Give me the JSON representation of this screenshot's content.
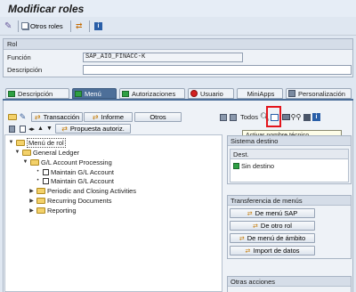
{
  "window": {
    "title": "Modificar roles"
  },
  "toolbar": {
    "other_roles_label": "Otros roles"
  },
  "role": {
    "header": "Rol",
    "function_label": "Función",
    "function_value": "SAP_AIO_FINACC-K",
    "description_label": "Descripción",
    "description_value": ""
  },
  "tabs": [
    {
      "label": "Descripción",
      "status": "done",
      "color": "#2ea043"
    },
    {
      "label": "Menú",
      "status": "active",
      "color": "#2ea043"
    },
    {
      "label": "Autorizaciones",
      "status": "done",
      "color": "#2ea043"
    },
    {
      "label": "Usuario",
      "status": "error",
      "color": "#d32020"
    },
    {
      "label": "MiniApps",
      "status": "none"
    },
    {
      "label": "Personalización",
      "status": "none"
    }
  ],
  "menu_toolbar": {
    "transaction_label": "Transacción",
    "report_label": "Informe",
    "other_label": "Otros",
    "proposal_label": "Propuesta autoriz.",
    "all_label": "Todos"
  },
  "tooltip": "Activar nombre técnico",
  "tree": {
    "root": "Menú de rol",
    "items": [
      {
        "label": "General Ledger",
        "level": 1,
        "expanded": true
      },
      {
        "label": "G/L Account Processing",
        "level": 2,
        "expanded": true
      },
      {
        "label": "Maintain G/L Account",
        "level": 3
      },
      {
        "label": "Maintain G/L Account",
        "level": 3
      },
      {
        "label": "Periodic and Closing Activities",
        "level": 2,
        "expanded": false
      },
      {
        "label": "Recurring Documents",
        "level": 2,
        "expanded": false
      },
      {
        "label": "Reporting",
        "level": 2,
        "expanded": false
      }
    ]
  },
  "target_system": {
    "header": "Sistema destino",
    "column": "Dest.",
    "value": "Sin destino",
    "status_color": "#2ea043"
  },
  "menu_transfer": {
    "header": "Transferencia de menús",
    "buttons": [
      "De menú SAP",
      "De otro rol",
      "De menú de ámbito",
      "Import de datos"
    ]
  },
  "other_actions": {
    "header": "Otras acciones"
  },
  "colors": {
    "accent": "#4d6f99",
    "highlight": "#e4151c"
  }
}
